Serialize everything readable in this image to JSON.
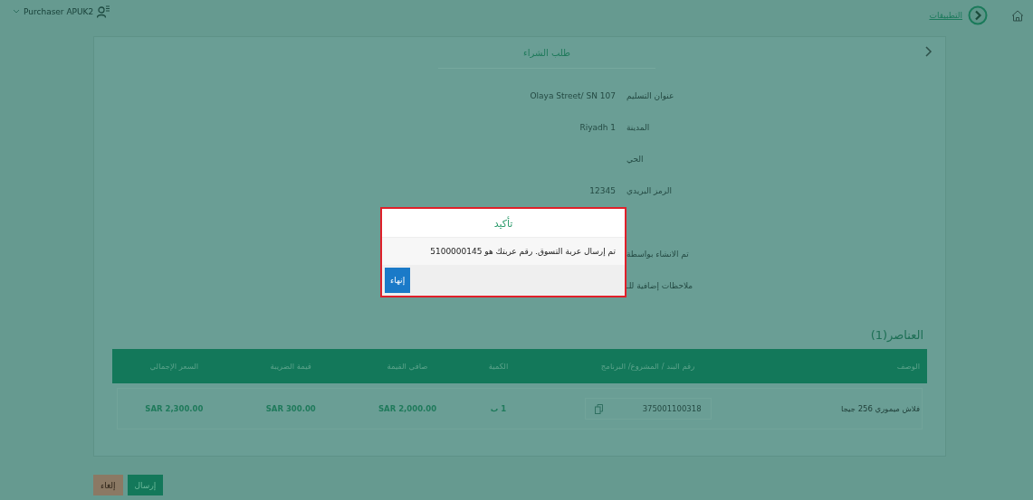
{
  "header": {
    "user": "Purchaser APUK2",
    "nav_link": "التطبيقات"
  },
  "card": {
    "title": "طلب الشراء",
    "fields": [
      {
        "label": "عنوان التسليم",
        "value": "Olaya Street/ SN 107"
      },
      {
        "label": "المدينة",
        "value": "Riyadh 1"
      },
      {
        "label": "الحي"
      },
      {
        "label": "الرمز البريدي",
        "value": "12345"
      },
      {
        "label": "تم الانشاء بواسطة"
      },
      {
        "label": "ملاحظات إضافية للـ"
      }
    ]
  },
  "dialog": {
    "title": "تأكيد",
    "message": "تم إرسال عربة التسوق. رقم عربتك هو 5100000145",
    "button": "إنهاء"
  },
  "items": {
    "heading": "العناصر(1)",
    "columns": [
      "الوصف",
      "رقم البند / المشروع/ البرنامج",
      "الكمية",
      "صافي القيمة",
      "قيمة الضريبة",
      "السعر الإجمالي"
    ],
    "rows": [
      {
        "description": "فلاش ميموري 256 جيجا",
        "item_number": "375001100318",
        "quantity": "1 ب",
        "net_value": "SAR 2,000.00",
        "tax": "SAR 300.00",
        "total": "SAR 2,300.00"
      }
    ]
  },
  "actions": [
    {
      "label": "إرسال",
      "kind": "submit"
    },
    {
      "label": "إلغاء",
      "kind": "cancel"
    }
  ]
}
